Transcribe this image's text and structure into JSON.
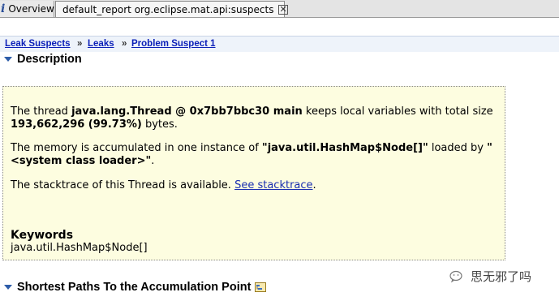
{
  "tabs": [
    {
      "label": "Overview",
      "icon": "info-icon"
    },
    {
      "label": "default_report  org.eclipse.mat.api:suspects",
      "icon": "heap-dump-icon",
      "closable": true
    }
  ],
  "breadcrumb": [
    "Leak Suspects",
    "Leaks",
    "Problem Suspect 1"
  ],
  "breadcrumb_separator": "»",
  "sections": {
    "description": "Description",
    "shortest_paths": "Shortest Paths To the Accumulation Point"
  },
  "description": {
    "p1_prefix": "The thread ",
    "p1_thread": "java.lang.Thread @ 0x7bb7bbc30 main",
    "p1_middle": " keeps local variables with total size ",
    "p1_size": "193,662,296 (99.73%)",
    "p1_suffix": " bytes.",
    "p2_prefix": "The memory is accumulated in one instance of ",
    "p2_class": "\"java.util.HashMap$Node[]\"",
    "p2_middle": " loaded by ",
    "p2_loader": "\"<system class loader>\"",
    "p2_suffix": ".",
    "p3_prefix": "The stacktrace of this Thread is available. ",
    "p3_link": "See stacktrace",
    "p3_suffix": ".",
    "keywords_title": "Keywords",
    "keywords_value": "java.util.HashMap$Node[]"
  },
  "watermark": "思无邪了吗",
  "colors": {
    "link": "#1a2fb0",
    "description_bg": "#fdfde0",
    "collapse_triangle": "#2d5ca8"
  }
}
